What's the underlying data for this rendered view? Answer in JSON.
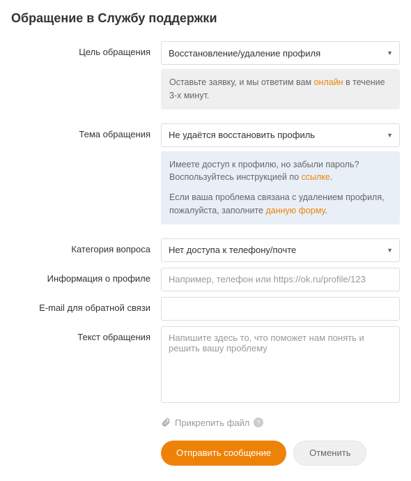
{
  "title": "Обращение в Службу поддержки",
  "fields": {
    "purpose": {
      "label": "Цель обращения",
      "value": "Восстановление/удаление профиля"
    },
    "topic": {
      "label": "Тема обращения",
      "value": "Не удаётся восстановить профиль"
    },
    "category": {
      "label": "Категория вопроса",
      "value": "Нет доступа к телефону/почте"
    },
    "profile_info": {
      "label": "Информация о профиле",
      "placeholder": "Например, телефон или https://ok.ru/profile/123"
    },
    "email": {
      "label": "E-mail для обратной связи",
      "placeholder": ""
    },
    "message": {
      "label": "Текст обращения",
      "placeholder": "Напишите здесь то, что поможет нам понять и решить вашу проблему"
    }
  },
  "info1": {
    "pre": "Оставьте заявку, и мы ответим вам ",
    "link": "онлайн",
    "post": " в течение 3-х минут."
  },
  "info2": {
    "p1_pre": "Имеете доступ к профилю, но забыли пароль? Воспользуйтесь инструкцией по ",
    "p1_link": "ссылке",
    "p1_post": ".",
    "p2_pre": "Если ваша проблема связана с удалением профиля, пожалуйста, заполните ",
    "p2_link": "данную форму",
    "p2_post": "."
  },
  "attach": {
    "label": "Прикрепить файл"
  },
  "buttons": {
    "submit": "Отправить сообщение",
    "cancel": "Отменить"
  }
}
